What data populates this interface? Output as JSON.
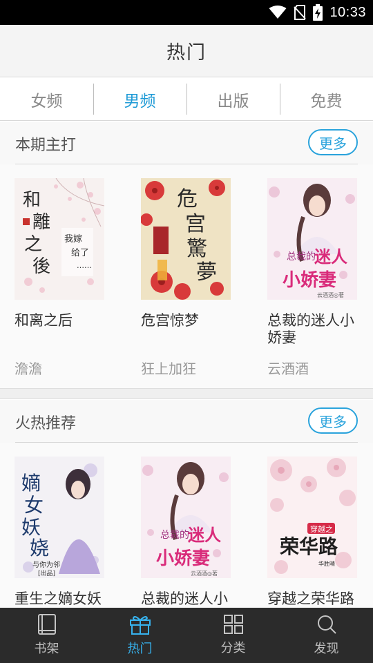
{
  "status_bar": {
    "time": "10:33",
    "icons": [
      "wifi-icon",
      "no-sim-icon",
      "battery-charging-icon"
    ]
  },
  "header": {
    "title": "热门"
  },
  "tabs": [
    {
      "label": "女频",
      "active": false
    },
    {
      "label": "男频",
      "active": true
    },
    {
      "label": "出版",
      "active": false
    },
    {
      "label": "免费",
      "active": false
    }
  ],
  "sections": [
    {
      "title": "本期主打",
      "more_label": "更多",
      "books": [
        {
          "title": "和离之后",
          "author": "澹澹",
          "cover_text": [
            "和離之後",
            "我嫁给了……"
          ]
        },
        {
          "title": "危宫惊梦",
          "author": "狂上加狂",
          "cover_text": [
            "危宫驚夢"
          ]
        },
        {
          "title": "总裁的迷人小娇妻",
          "author": "云酒酒",
          "cover_text": [
            "总裁的",
            "迷人",
            "小娇妻",
            "云酒酒◎著"
          ]
        }
      ]
    },
    {
      "title": "火热推荐",
      "more_label": "更多",
      "books": [
        {
          "title": "重生之嫡女妖娆",
          "author": "",
          "cover_text": [
            "嫡女妖娆",
            "与你为邻",
            "[出品]"
          ]
        },
        {
          "title": "总裁的迷人小娇妻",
          "author": "",
          "cover_text": [
            "总裁的",
            "迷人",
            "小娇妻",
            "云酒酒◎著"
          ]
        },
        {
          "title": "穿越之荣华路",
          "author": "",
          "cover_text": [
            "穿越之",
            "荣华路",
            "华胜晴"
          ]
        }
      ]
    }
  ],
  "bottom_nav": [
    {
      "label": "书架",
      "icon": "book-icon",
      "active": false
    },
    {
      "label": "热门",
      "icon": "gift-icon",
      "active": true
    },
    {
      "label": "分类",
      "icon": "grid-icon",
      "active": false
    },
    {
      "label": "发现",
      "icon": "search-icon",
      "active": false
    }
  ],
  "colors": {
    "accent": "#1e9ad6",
    "nav_active": "#37b3ef",
    "nav_bg": "#2b2b2b",
    "header_bg": "#f4f4f4"
  }
}
